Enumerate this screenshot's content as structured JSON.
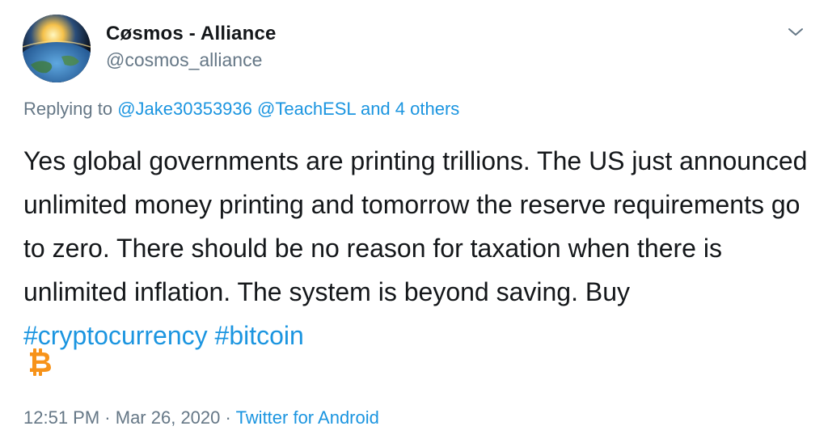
{
  "author": {
    "display_name": "Cøsmos - Alliance",
    "handle": "@cosmos_alliance"
  },
  "reply": {
    "prefix": "Replying to",
    "mentions": [
      "@Jake30353936",
      "@TeachESL"
    ],
    "conjunction": "and",
    "others": "4 others"
  },
  "body": {
    "text": "Yes global governments are printing trillions. The US just announced unlimited money printing and tomorrow the reserve requirements go to zero. There should be no reason for taxation when there is unlimited inflation. The system is beyond saving. Buy",
    "hashtags": [
      "#cryptocurrency",
      "#bitcoin"
    ],
    "emoji": "bitcoin-icon"
  },
  "meta": {
    "time": "12:51 PM",
    "separator": "·",
    "date": "Mar 26, 2020",
    "source": "Twitter for Android"
  },
  "icons": {
    "menu": "chevron-down-icon",
    "avatar": "earth-avatar"
  },
  "colors": {
    "link": "#1b95e0",
    "muted": "#657786",
    "text": "#14171a",
    "bitcoin": "#f7931a"
  }
}
